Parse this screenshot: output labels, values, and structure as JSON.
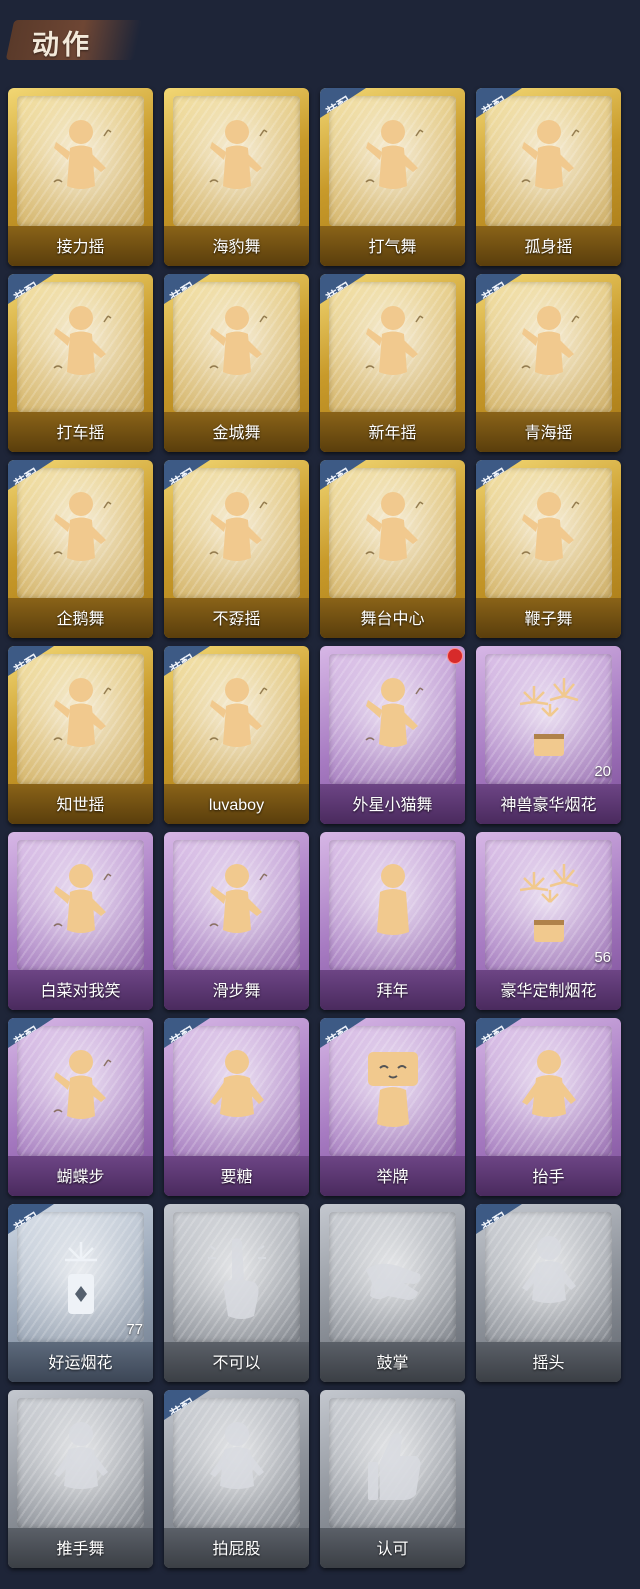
{
  "header": {
    "title": "动作"
  },
  "equip_label": "装配",
  "colors": {
    "gold": "#c89a2a",
    "purple": "#a77bc2",
    "silver": "#9aa7b8",
    "grey": "#8e939b",
    "badge": "#3d5a85",
    "new_dot": "#d72a2a"
  },
  "actions": [
    {
      "name": "接力摇",
      "rarity": "gold",
      "equipped": false,
      "icon": "dancing-figure-icon"
    },
    {
      "name": "海豹舞",
      "rarity": "gold",
      "equipped": false,
      "icon": "dancing-figure-icon"
    },
    {
      "name": "打气舞",
      "rarity": "gold",
      "equipped": true,
      "icon": "dancing-figure-icon"
    },
    {
      "name": "孤身摇",
      "rarity": "gold",
      "equipped": true,
      "icon": "dancing-figure-icon"
    },
    {
      "name": "打车摇",
      "rarity": "gold",
      "equipped": true,
      "icon": "dancing-figure-icon"
    },
    {
      "name": "金城舞",
      "rarity": "gold",
      "equipped": true,
      "icon": "dancing-figure-icon"
    },
    {
      "name": "新年摇",
      "rarity": "gold",
      "equipped": true,
      "icon": "dancing-figure-icon"
    },
    {
      "name": "青海摇",
      "rarity": "gold",
      "equipped": true,
      "icon": "dancing-figure-icon"
    },
    {
      "name": "企鹅舞",
      "rarity": "gold",
      "equipped": true,
      "icon": "dancing-figure-icon"
    },
    {
      "name": "不孬摇",
      "rarity": "gold",
      "equipped": true,
      "icon": "dancing-figure-icon"
    },
    {
      "name": "舞台中心",
      "rarity": "gold",
      "equipped": true,
      "icon": "dancing-figure-icon"
    },
    {
      "name": "鞭子舞",
      "rarity": "gold",
      "equipped": true,
      "icon": "dancing-figure-icon"
    },
    {
      "name": "知世摇",
      "rarity": "gold",
      "equipped": true,
      "icon": "dancing-figure-icon"
    },
    {
      "name": "luvaboy",
      "rarity": "gold",
      "equipped": true,
      "icon": "dancing-figure-icon"
    },
    {
      "name": "外星小猫舞",
      "rarity": "purple",
      "equipped": false,
      "icon": "dancing-figure-icon",
      "is_new": true
    },
    {
      "name": "神兽豪华烟花",
      "rarity": "purple",
      "equipped": false,
      "icon": "fireworks-icon",
      "count": "20"
    },
    {
      "name": "白菜对我笑",
      "rarity": "purple",
      "equipped": false,
      "icon": "dancing-figure-icon"
    },
    {
      "name": "滑步舞",
      "rarity": "purple",
      "equipped": false,
      "icon": "dancing-figure-icon"
    },
    {
      "name": "拜年",
      "rarity": "purple",
      "equipped": false,
      "icon": "greeting-figure-icon"
    },
    {
      "name": "豪华定制烟花",
      "rarity": "purple",
      "equipped": false,
      "icon": "fireworks-icon",
      "count": "56"
    },
    {
      "name": "蝴蝶步",
      "rarity": "purple",
      "equipped": true,
      "icon": "dancing-figure-icon"
    },
    {
      "name": "要糖",
      "rarity": "purple",
      "equipped": true,
      "icon": "figure-icon"
    },
    {
      "name": "举牌",
      "rarity": "purple",
      "equipped": true,
      "icon": "sign-figure-icon"
    },
    {
      "name": "抬手",
      "rarity": "purple",
      "equipped": true,
      "icon": "figure-icon"
    },
    {
      "name": "好运烟花",
      "rarity": "silver",
      "equipped": true,
      "icon": "firework-can-icon",
      "count": "77"
    },
    {
      "name": "不可以",
      "rarity": "grey",
      "equipped": false,
      "icon": "finger-icon"
    },
    {
      "name": "鼓掌",
      "rarity": "grey",
      "equipped": false,
      "icon": "clapping-hands-icon"
    },
    {
      "name": "摇头",
      "rarity": "grey",
      "equipped": true,
      "icon": "figure-icon"
    },
    {
      "name": "推手舞",
      "rarity": "grey",
      "equipped": false,
      "icon": "figure-icon"
    },
    {
      "name": "拍屁股",
      "rarity": "grey",
      "equipped": true,
      "icon": "figure-icon"
    },
    {
      "name": "认可",
      "rarity": "grey",
      "equipped": false,
      "icon": "thumbs-up-icon"
    }
  ]
}
